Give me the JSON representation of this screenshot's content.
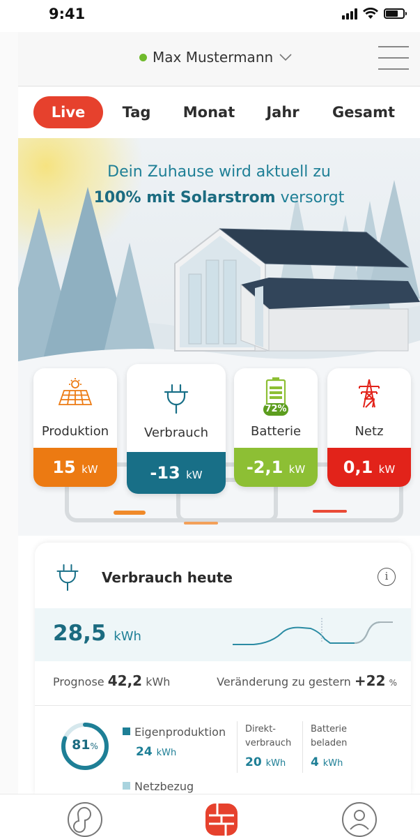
{
  "status_bar": {
    "time": "9:41"
  },
  "header": {
    "user_name": "Max Mustermann",
    "status_color": "#6fba2c"
  },
  "tabs": [
    {
      "label": "Live",
      "active": true
    },
    {
      "label": "Tag",
      "active": false
    },
    {
      "label": "Monat",
      "active": false
    },
    {
      "label": "Jahr",
      "active": false
    },
    {
      "label": "Gesamt",
      "active": false
    }
  ],
  "hero": {
    "line1": "Dein Zuhause wird aktuell zu",
    "line2_bold": "100% mit Solarstrom",
    "line2_rest": " versorgt"
  },
  "tiles": [
    {
      "label": "Produktion",
      "value": "15",
      "unit": "kW",
      "color": "#ec7a12",
      "icon": "solar-panel-icon"
    },
    {
      "label": "Verbrauch",
      "value": "-13",
      "unit": "kW",
      "color": "#186f87",
      "icon": "plug-icon"
    },
    {
      "label": "Batterie",
      "value": "-2,1",
      "unit": "kW",
      "color": "#8dbf34",
      "icon": "battery-icon",
      "badge": "72%"
    },
    {
      "label": "Netz",
      "value": "0,1",
      "unit": "kW",
      "color": "#e2231a",
      "icon": "power-tower-icon"
    }
  ],
  "card": {
    "title": "Verbrauch heute",
    "value": "28,5",
    "unit": "kWh",
    "prognose_label": "Prognose",
    "prognose_value": "42,2",
    "prognose_unit": "kWh",
    "change_label": "Veränderung zu gestern",
    "change_value": "+22",
    "change_unit": "%",
    "donut_percent": "81",
    "donut_unit": "%",
    "donut_fraction": 0.81,
    "legend_eigen": "Eigenproduktion",
    "eigen_value": "24",
    "eigen_unit": "kWh",
    "direkt_line1": "Direkt-",
    "direkt_line2": "verbrauch",
    "direkt_value": "20",
    "direkt_unit": "kWh",
    "batterie_line1": "Batterie",
    "batterie_line2": "beladen",
    "batterie_value": "4",
    "batterie_unit": "kWh",
    "legend_netz": "Netzbezug"
  },
  "bottom_nav": [
    {
      "icon": "analytics-icon"
    },
    {
      "icon": "dashboard-icon",
      "active": true
    },
    {
      "icon": "profile-icon"
    }
  ]
}
